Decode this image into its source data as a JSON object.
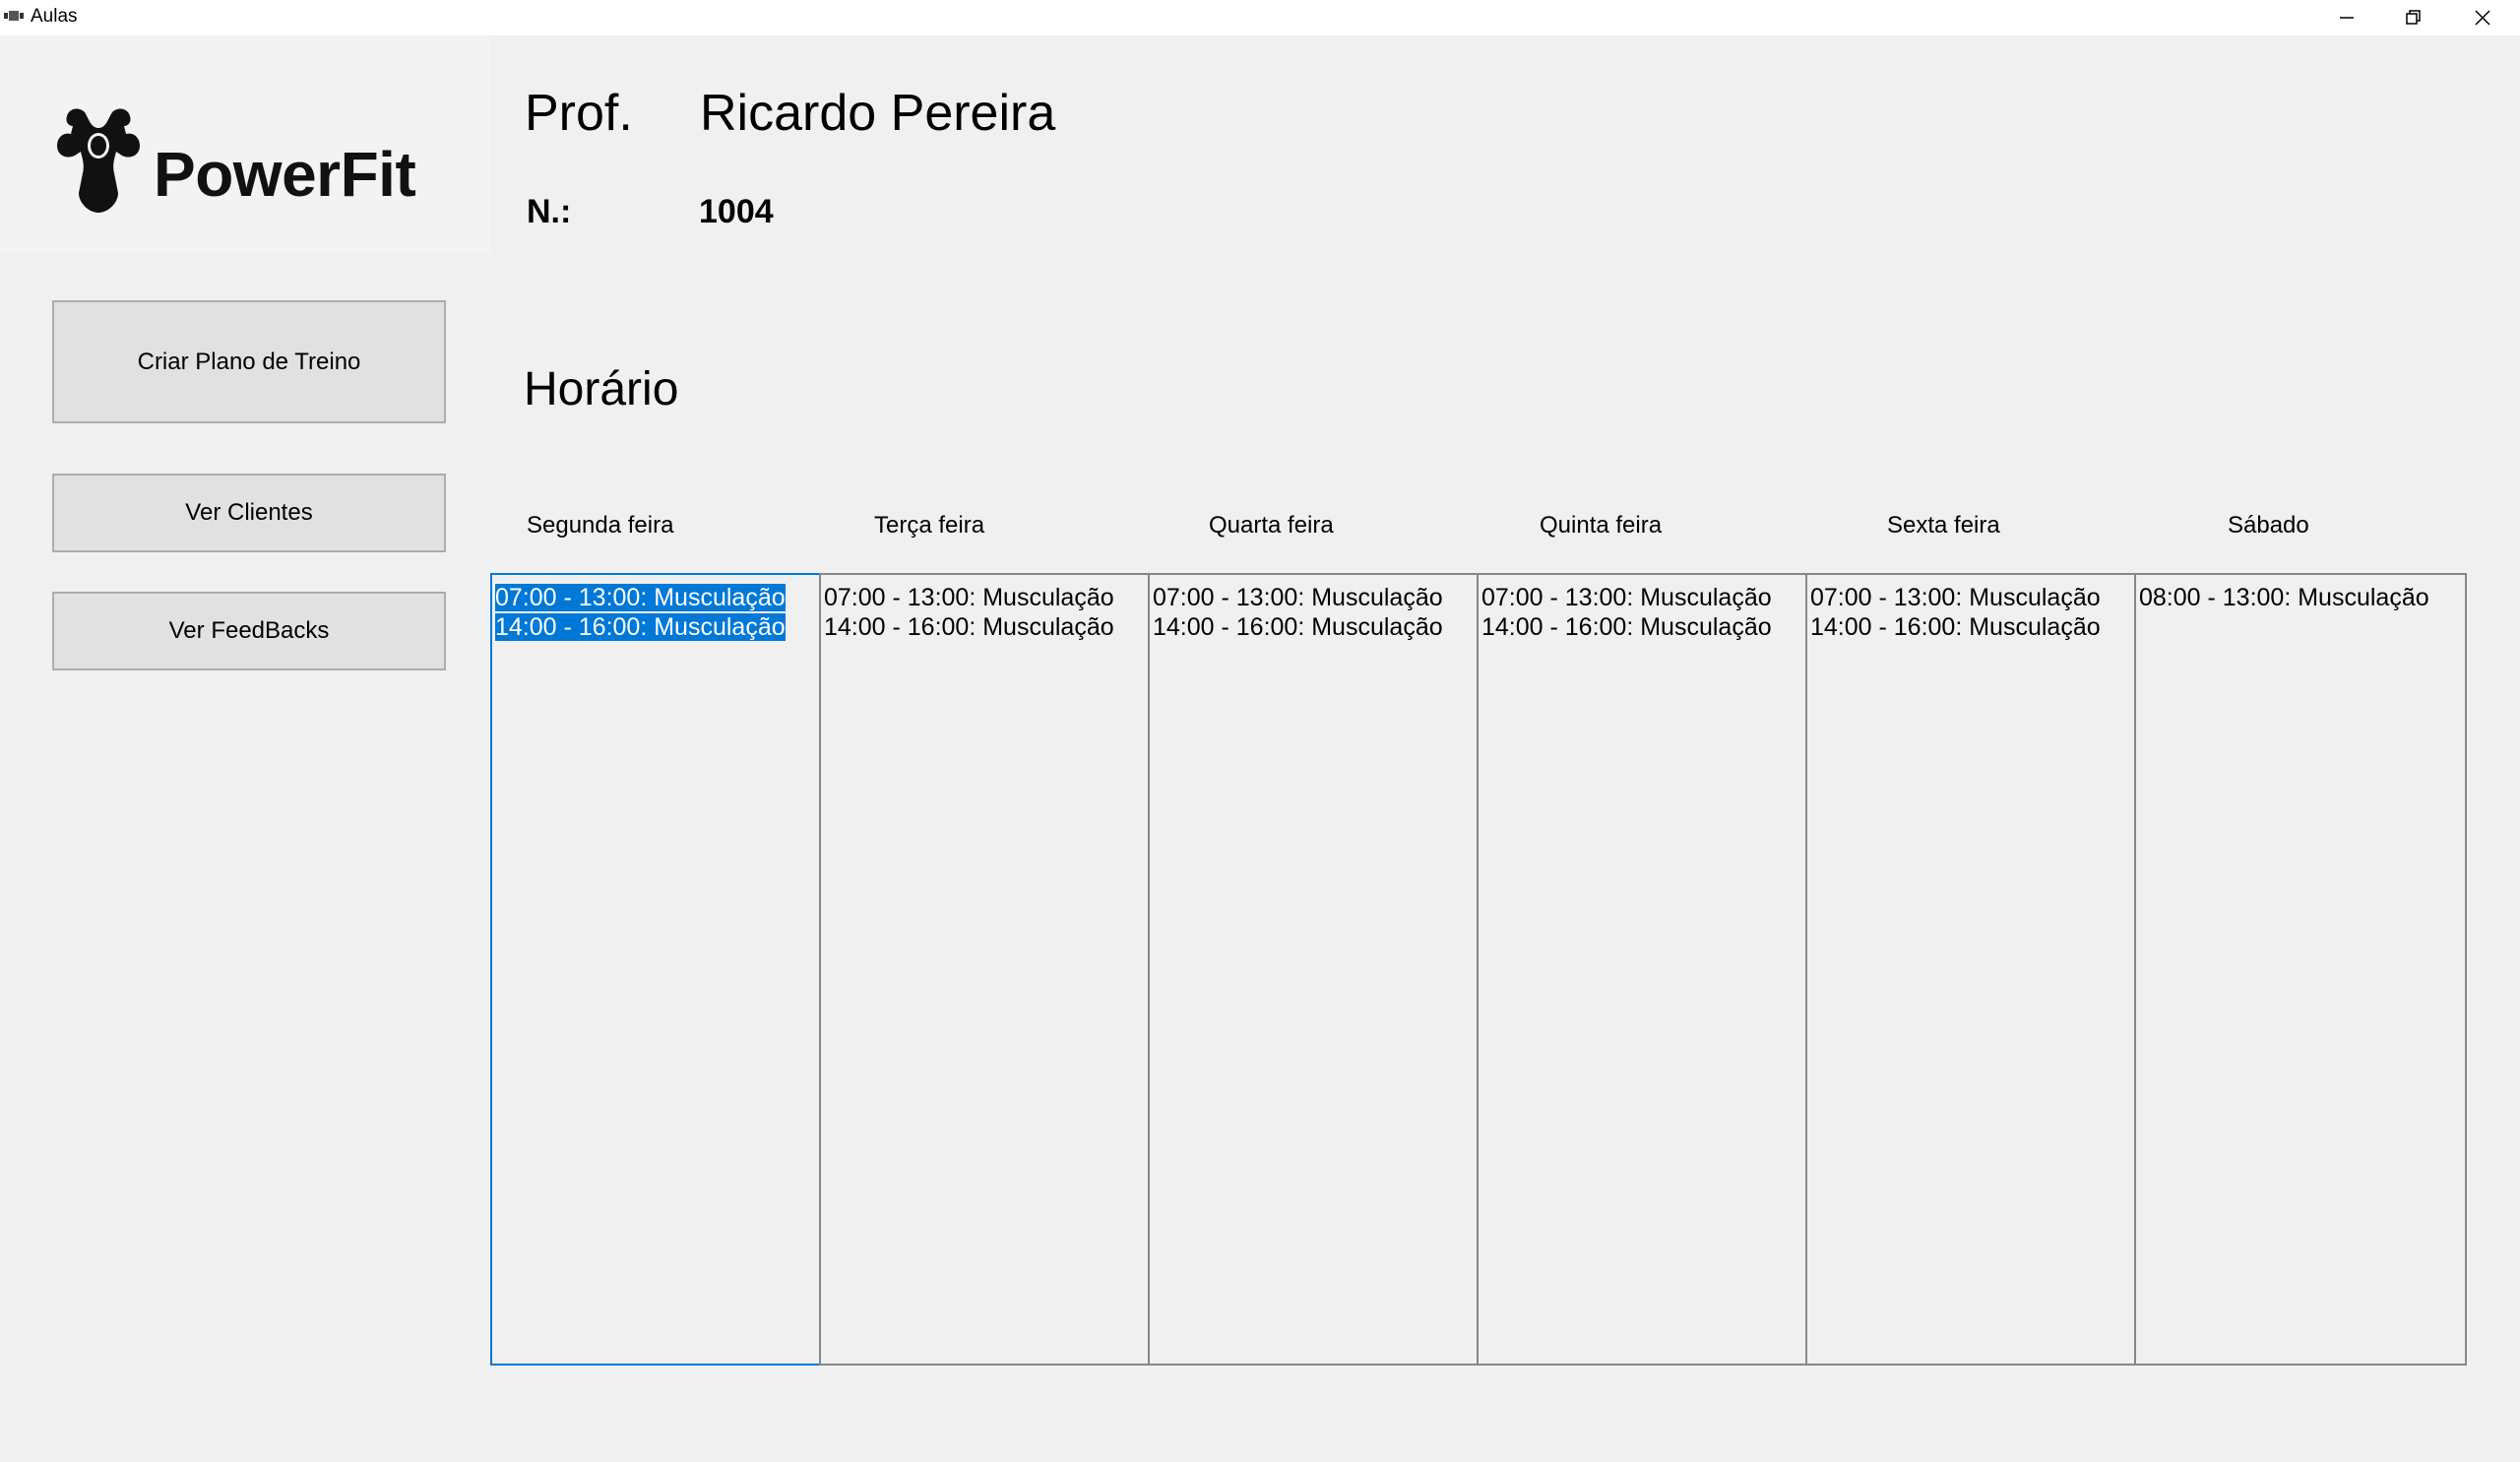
{
  "window": {
    "title": "Aulas"
  },
  "logo": {
    "text": "PowerFit"
  },
  "sidebar": {
    "buttons": [
      {
        "label": "Criar Plano de Treino"
      },
      {
        "label": "Ver Clientes"
      },
      {
        "label": "Ver FeedBacks"
      }
    ]
  },
  "professor": {
    "prefix": "Prof.",
    "name": "Ricardo Pereira",
    "number_label": "N.:",
    "number": "1004"
  },
  "schedule": {
    "title": "Horário",
    "days": [
      {
        "name": "Segunda feira",
        "entries": [
          "07:00 - 13:00: Musculação",
          "14:00 - 16:00: Musculação"
        ],
        "selected": true
      },
      {
        "name": "Terça feira",
        "entries": [
          "07:00 - 13:00: Musculação",
          "14:00 - 16:00: Musculação"
        ]
      },
      {
        "name": "Quarta feira",
        "entries": [
          "07:00 - 13:00: Musculação",
          "14:00 - 16:00: Musculação"
        ]
      },
      {
        "name": "Quinta feira",
        "entries": [
          "07:00 - 13:00: Musculação",
          "14:00 - 16:00: Musculação"
        ]
      },
      {
        "name": "Sexta feira",
        "entries": [
          "07:00 - 13:00: Musculação",
          "14:00 - 16:00: Musculação"
        ]
      },
      {
        "name": "Sábado",
        "entries": [
          "08:00 - 13:00: Musculação"
        ]
      }
    ]
  },
  "colors": {
    "selection": "#0078d7",
    "button_bg": "#e1e1e1",
    "window_bg": "#f0f0f0"
  }
}
